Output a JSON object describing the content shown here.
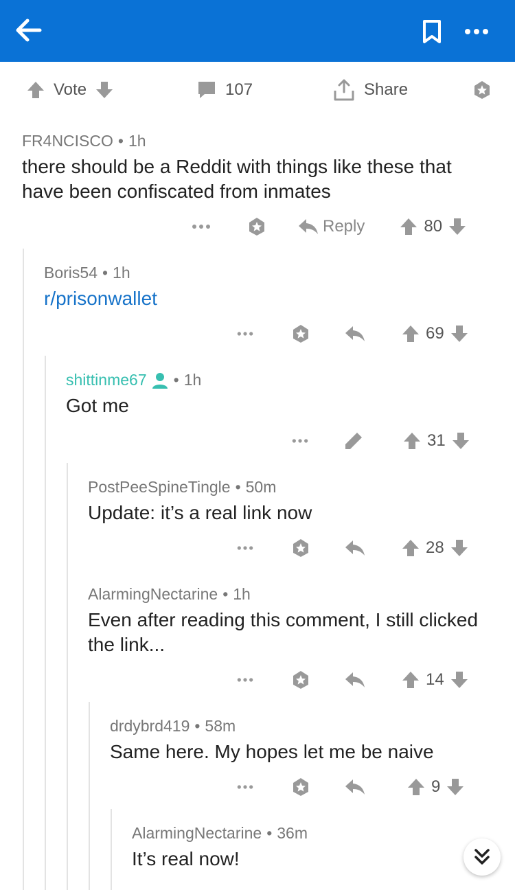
{
  "colors": {
    "header": "#0a72d6",
    "link": "#1773c9",
    "op_author": "#37bfb0",
    "icon_gray": "#999999"
  },
  "header": {
    "back_icon": "arrow-left-icon",
    "bookmark_icon": "bookmark-icon",
    "more_icon": "more-icon"
  },
  "post_actions": {
    "vote_label": "Vote",
    "comment_count": "107",
    "share_label": "Share"
  },
  "comments": [
    {
      "author": "FR4NCISCO",
      "time": "1h",
      "body": "there should be a Reddit with things like these that have been confiscated from inmates",
      "reply_label": "Reply",
      "score": "80"
    },
    {
      "author": "Boris54",
      "time": "1h",
      "body": "r/prisonwallet",
      "score": "69"
    },
    {
      "author": "shittinme67",
      "time": "1h",
      "body": "Got me",
      "score": "31"
    },
    {
      "author": "PostPeeSpineTingle",
      "time": "50m",
      "body": "Update: it’s a real link now",
      "score": "28"
    },
    {
      "author": "AlarmingNectarine",
      "time": "1h",
      "body": "Even after reading this comment, I still clicked the link...",
      "score": "14"
    },
    {
      "author": "drdybrd419",
      "time": "58m",
      "body": "Same here. My hopes let me be naive",
      "score": "9"
    },
    {
      "author": "AlarmingNectarine",
      "time": "36m",
      "body": "It’s real now!"
    }
  ],
  "separator": "•"
}
